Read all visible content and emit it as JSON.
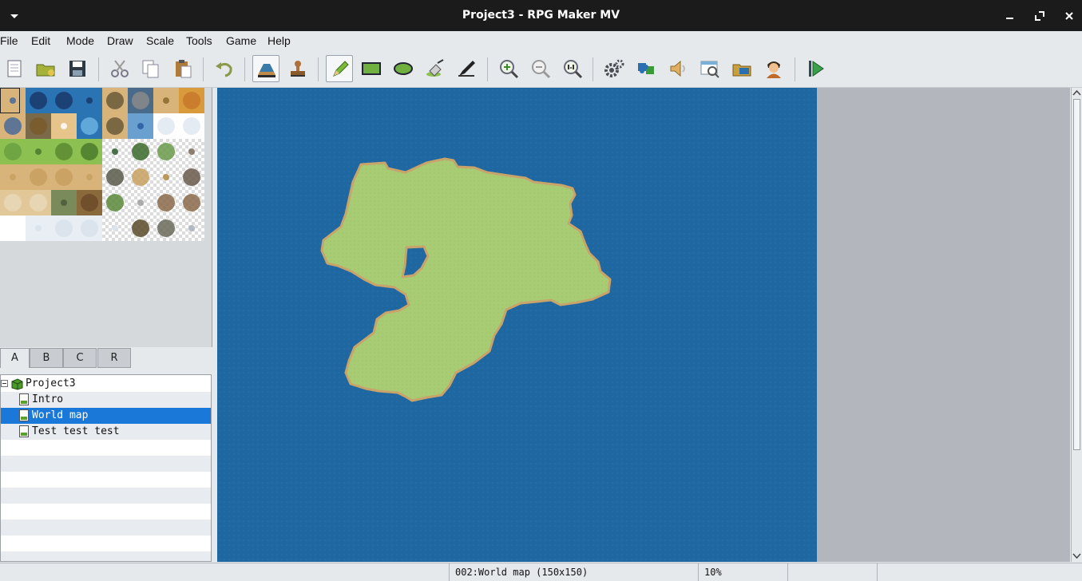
{
  "window": {
    "title": "Project3 - RPG Maker MV"
  },
  "menu": [
    "File",
    "Edit",
    "Mode",
    "Draw",
    "Scale",
    "Tools",
    "Game",
    "Help"
  ],
  "toolbar": {
    "buttons": [
      {
        "name": "new-project",
        "icon": "document-icon"
      },
      {
        "name": "open-project",
        "icon": "folder-icon"
      },
      {
        "name": "save-project",
        "icon": "floppy-icon"
      },
      {
        "name": "cut",
        "icon": "scissors-icon"
      },
      {
        "name": "copy",
        "icon": "copy-icon"
      },
      {
        "name": "paste",
        "icon": "clipboard-icon"
      },
      {
        "name": "undo",
        "icon": "undo-arrow-icon"
      },
      {
        "name": "map-mode",
        "icon": "map-layers-icon",
        "active": true
      },
      {
        "name": "event-mode",
        "icon": "stamp-icon"
      },
      {
        "name": "pencil",
        "icon": "pencil-icon",
        "active": true
      },
      {
        "name": "rectangle",
        "icon": "rectangle-icon"
      },
      {
        "name": "ellipse",
        "icon": "ellipse-icon"
      },
      {
        "name": "flood-fill",
        "icon": "fill-icon"
      },
      {
        "name": "shadow-pen",
        "icon": "shadow-pen-icon"
      },
      {
        "name": "zoom-in",
        "icon": "zoom-in-icon"
      },
      {
        "name": "zoom-out",
        "icon": "zoom-out-icon"
      },
      {
        "name": "actual-size",
        "icon": "zoom-1to1-icon"
      },
      {
        "name": "database",
        "icon": "gears-icon"
      },
      {
        "name": "plugin-manager",
        "icon": "puzzle-icon"
      },
      {
        "name": "sound-test",
        "icon": "speaker-icon"
      },
      {
        "name": "event-searcher",
        "icon": "search-window-icon"
      },
      {
        "name": "resource-manager",
        "icon": "resource-folder-icon"
      },
      {
        "name": "character-generator",
        "icon": "character-icon"
      },
      {
        "name": "playtest",
        "icon": "play-icon"
      }
    ]
  },
  "tileset_tabs": [
    "A",
    "B",
    "C",
    "R"
  ],
  "selected_tab": "A",
  "map_tree": {
    "items": [
      {
        "label": "Project3",
        "type": "project",
        "icon": "project-box-icon"
      },
      {
        "label": "Intro",
        "type": "map",
        "icon": "map-sheet-icon"
      },
      {
        "label": "World map",
        "type": "map",
        "selected": true,
        "icon": "map-sheet-icon"
      },
      {
        "label": "Test test test",
        "type": "map",
        "icon": "map-sheet-icon"
      }
    ]
  },
  "status": {
    "map_info": "002:World map (150x150)",
    "zoom": "10%"
  },
  "colors": {
    "titlebar": "#1b1b1b",
    "selection": "#1a78d8",
    "ocean": "#1f67a0",
    "land": "#a8cc74",
    "shore": "#c8a36a",
    "map_backdrop": "#b3b6bc"
  }
}
